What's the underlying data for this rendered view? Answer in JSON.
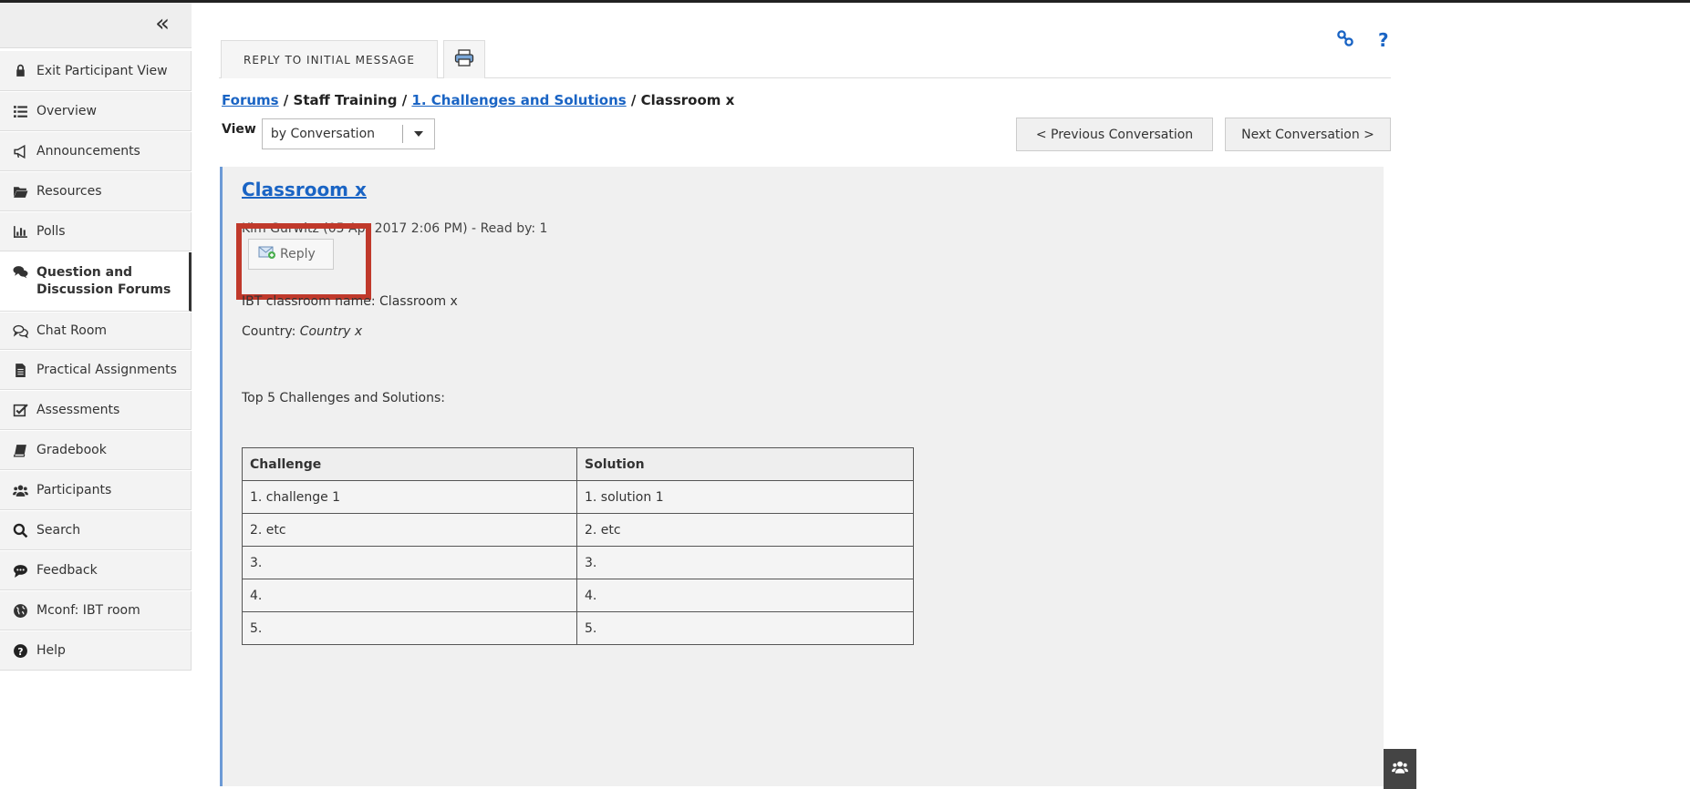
{
  "sidebar": {
    "collapse_glyph": "«",
    "items": [
      {
        "label": "Exit Participant View",
        "icon": "lock-icon"
      },
      {
        "label": "Overview",
        "icon": "list-icon"
      },
      {
        "label": "Announcements",
        "icon": "megaphone-icon"
      },
      {
        "label": "Resources",
        "icon": "folder-open-icon"
      },
      {
        "label": "Polls",
        "icon": "bar-chart-icon"
      },
      {
        "label_line1": "Question and",
        "label_line2": "Discussion Forums",
        "icon": "comments-icon",
        "active": true
      },
      {
        "label": "Chat Room",
        "icon": "chat-icon"
      },
      {
        "label": "Practical Assignments",
        "icon": "file-icon"
      },
      {
        "label": "Assessments",
        "icon": "checkbox-icon"
      },
      {
        "label": "Gradebook",
        "icon": "book-icon"
      },
      {
        "label": "Participants",
        "icon": "users-icon"
      },
      {
        "label": "Search",
        "icon": "search-icon"
      },
      {
        "label": "Feedback",
        "icon": "comment-icon"
      },
      {
        "label": "Mconf: IBT room",
        "icon": "globe-icon"
      },
      {
        "label": "Help",
        "icon": "question-circle-icon"
      }
    ]
  },
  "toolbar": {
    "reply_initial_label": "REPLY TO INITIAL MESSAGE",
    "print_icon": "print-icon",
    "link_icon": "link-icon",
    "help_label": "?"
  },
  "breadcrumb": {
    "forums": "Forums",
    "sep1": " / ",
    "staff_training": "Staff Training",
    "sep2": " / ",
    "topic": "1. Challenges and Solutions",
    "sep3": " / ",
    "current": "Classroom x"
  },
  "view": {
    "label": "View",
    "selected": "by Conversation"
  },
  "nav": {
    "prev_label": "< Previous Conversation",
    "next_label": "Next Conversation >"
  },
  "message": {
    "title": "Classroom x",
    "meta": "Kim Gurwitz (05 Apr 2017 2:06 PM) - Read by: 1",
    "reply_label": "Reply",
    "line1": "IBT classroom name: Classroom x",
    "country_prefix": "Country: ",
    "country_value": "Country x",
    "line3": "Top 5 Challenges and Solutions:",
    "table": {
      "headers": [
        "Challenge",
        "Solution"
      ],
      "rows": [
        [
          "1. challenge 1",
          "1. solution 1"
        ],
        [
          "2. etc",
          "2. etc"
        ],
        [
          "3.",
          "3."
        ],
        [
          "4.",
          "4."
        ],
        [
          "5.",
          "5."
        ]
      ]
    }
  },
  "colors": {
    "link": "#1a64c4",
    "highlight": "#c0392b",
    "panel_accent": "#6c9ad6"
  }
}
